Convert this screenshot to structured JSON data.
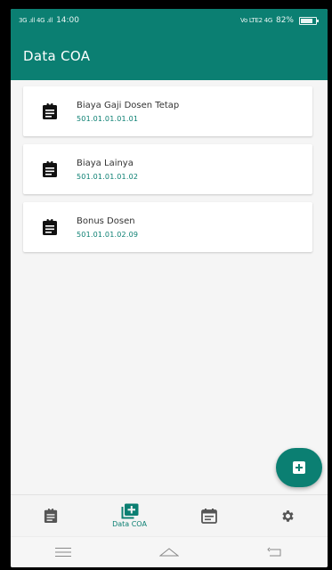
{
  "status_bar": {
    "signal_left": "3G .ıll 4G .ıll",
    "time": "14:00",
    "network": "Vo LTE2 4G",
    "battery": "82%",
    "battery_level": 0.82
  },
  "app_bar": {
    "title": "Data COA"
  },
  "coa_list": [
    {
      "name": "Biaya Gaji Dosen Tetap",
      "code": "501.01.01.01.01"
    },
    {
      "name": "Biaya Lainya",
      "code": "501.01.01.01.02"
    },
    {
      "name": "Bonus Dosen",
      "code": "501.01.01.02.09"
    }
  ],
  "bottom_nav": {
    "items": [
      {
        "icon": "clipboard-icon",
        "label": ""
      },
      {
        "icon": "add-box-icon",
        "label": "Data COA"
      },
      {
        "icon": "calendar-icon",
        "label": ""
      },
      {
        "icon": "gear-icon",
        "label": ""
      }
    ]
  },
  "colors": {
    "primary": "#0b7f72",
    "background": "#f5f5f5",
    "card": "#ffffff"
  }
}
